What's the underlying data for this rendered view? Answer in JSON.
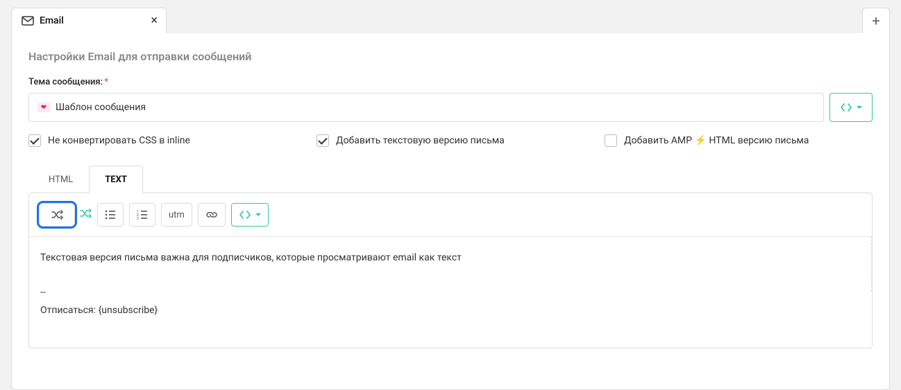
{
  "tab": {
    "label": "Email"
  },
  "section_title": "Настройки Email для отправки сообщений",
  "subject": {
    "label": "Тема сообщения:",
    "value": "Шаблон сообщения"
  },
  "checks": {
    "no_inline_css": {
      "label": "Не конвертировать CSS в inline",
      "checked": true
    },
    "add_text_version": {
      "label": "Добавить текстовую версию письма",
      "checked": true
    },
    "add_amp": {
      "label_pre": "Добавить AMP",
      "label_post": " HTML версию письма",
      "checked": false
    }
  },
  "editor_tabs": {
    "html": "HTML",
    "text": "TEXT"
  },
  "toolbar": {
    "utm": "utm"
  },
  "content": {
    "line1": "Текстовая версия письма важна для подписчиков, которые просматривают email как текст",
    "sep": "--",
    "line2": "Отписаться: {unsubscribe}"
  }
}
